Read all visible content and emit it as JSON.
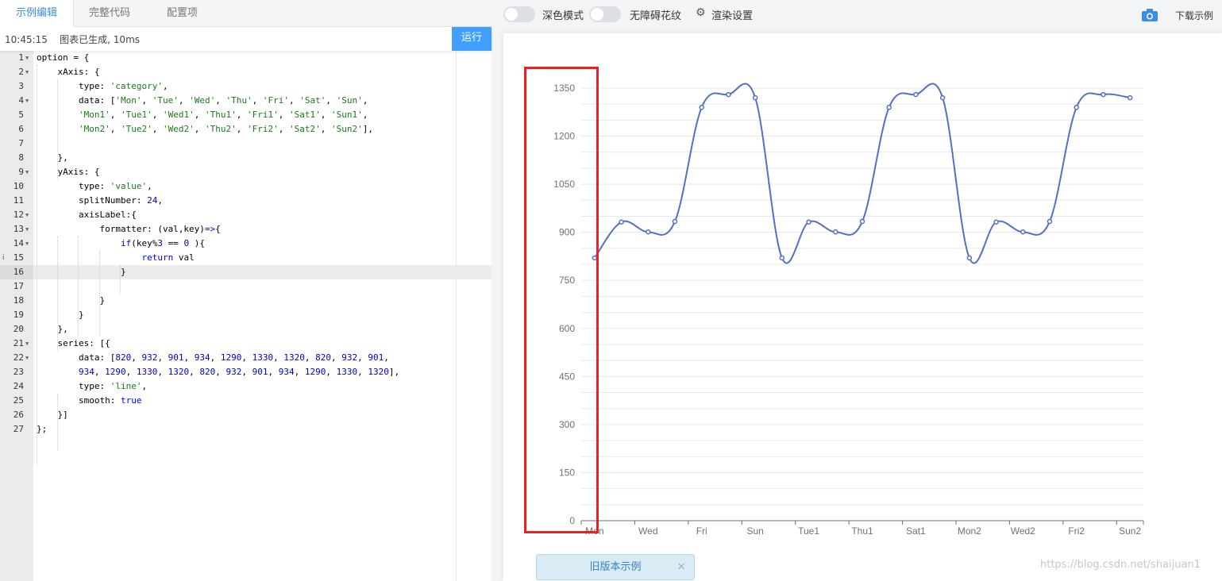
{
  "tabs": [
    {
      "label": "示例编辑"
    },
    {
      "label": "完整代码"
    },
    {
      "label": "配置项"
    }
  ],
  "status": {
    "time": "10:45:15",
    "message": "图表已生成, 10ms"
  },
  "run_label": "运行",
  "topbar": {
    "dark_mode": "深色模式",
    "accessible": "无障碍花纹",
    "render_settings": "渲染设置",
    "download": "下载示例",
    "gear_icon": "gear-icon",
    "camera_icon": "camera-icon"
  },
  "old_version_button": "旧版本示例",
  "watermark": "https://blog.csdn.net/shaijuan1",
  "colors": {
    "accent": "#409eff",
    "series": "#5470c6",
    "highlight_box": "#e62222"
  },
  "chart_data": {
    "type": "line",
    "smooth": true,
    "categories": [
      "Mon",
      "Tue",
      "Wed",
      "Thu",
      "Fri",
      "Sat",
      "Sun",
      "Mon1",
      "Tue1",
      "Wed1",
      "Thu1",
      "Fri1",
      "Sat1",
      "Sun1",
      "Mon2",
      "Tue2",
      "Wed2",
      "Thu2",
      "Fri2",
      "Sat2",
      "Sun2"
    ],
    "x_tick_labels": [
      "Mon",
      "Wed",
      "Fri",
      "Sun",
      "Tue1",
      "Thu1",
      "Sat1",
      "Mon2",
      "Wed2",
      "Fri2",
      "Sun2"
    ],
    "values": [
      820,
      932,
      901,
      934,
      1290,
      1330,
      1320,
      820,
      932,
      901,
      934,
      1290,
      1330,
      1320,
      820,
      932,
      901,
      934,
      1290,
      1330,
      1320
    ],
    "y_tick_labels": [
      "0",
      "150",
      "300",
      "450",
      "600",
      "750",
      "900",
      "1050",
      "1200",
      "1350"
    ],
    "ylim": [
      0,
      1350
    ],
    "grid": true
  }
}
